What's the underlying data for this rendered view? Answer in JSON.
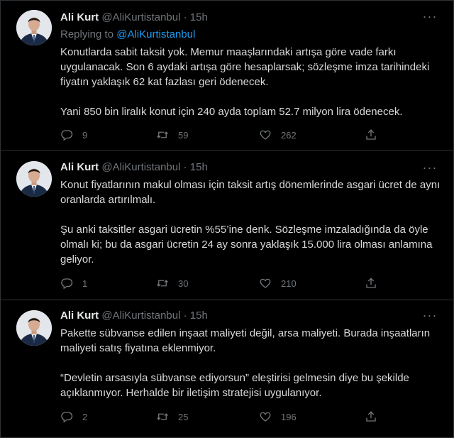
{
  "colors": {
    "background": "#000000",
    "divider": "#2f3336",
    "text": "#d9d9d9",
    "muted": "#71767b",
    "link": "#1d9bf0"
  },
  "tweets": [
    {
      "name": "Ali Kurt",
      "handle": "@AliKurtistanbul",
      "dot": "·",
      "time": "15h",
      "more": "···",
      "replying_prefix": "Replying to ",
      "replying_to": "@AliKurtistanbul",
      "paragraphs": [
        "Konutlarda sabit taksit yok. Memur maaşlarındaki artışa göre vade farkı uygulanacak. Son 6 aydaki artışa göre hesaplarsak; sözleşme imza tarihindeki fiyatın yaklaşık 62 kat fazlası geri ödenecek.",
        "Yani 850 bin liralık konut için 240 ayda toplam 52.7 milyon lira ödenecek."
      ],
      "replies": "9",
      "retweets": "59",
      "likes": "262",
      "icons": [
        "reply-icon",
        "retweet-icon",
        "like-icon",
        "share-icon"
      ]
    },
    {
      "name": "Ali Kurt",
      "handle": "@AliKurtistanbul",
      "dot": "·",
      "time": "15h",
      "more": "···",
      "paragraphs": [
        "Konut fiyatlarının makul olması için taksit artış dönemlerinde asgari ücret de aynı oranlarda artırılmalı.",
        "Şu anki taksitler asgari ücretin %55’ine denk. Sözleşme imzaladığında da öyle olmalı ki; bu da asgari ücretin 24 ay sonra yaklaşık 15.000 lira olması anlamına geliyor."
      ],
      "replies": "1",
      "retweets": "30",
      "likes": "210",
      "icons": [
        "reply-icon",
        "retweet-icon",
        "like-icon",
        "share-icon"
      ]
    },
    {
      "name": "Ali Kurt",
      "handle": "@AliKurtistanbul",
      "dot": "·",
      "time": "15h",
      "more": "···",
      "paragraphs": [
        "Pakette sübvanse edilen inşaat maliyeti değil, arsa maliyeti. Burada inşaatların maliyeti satış fiyatına eklenmiyor.",
        "“Devletin arsasıyla sübvanse ediyorsun” eleştirisi gelmesin diye bu şekilde açıklanmıyor. Herhalde bir iletişim stratejisi uygulanıyor."
      ],
      "replies": "2",
      "retweets": "25",
      "likes": "196",
      "icons": [
        "reply-icon",
        "retweet-icon",
        "like-icon",
        "share-icon"
      ]
    }
  ]
}
